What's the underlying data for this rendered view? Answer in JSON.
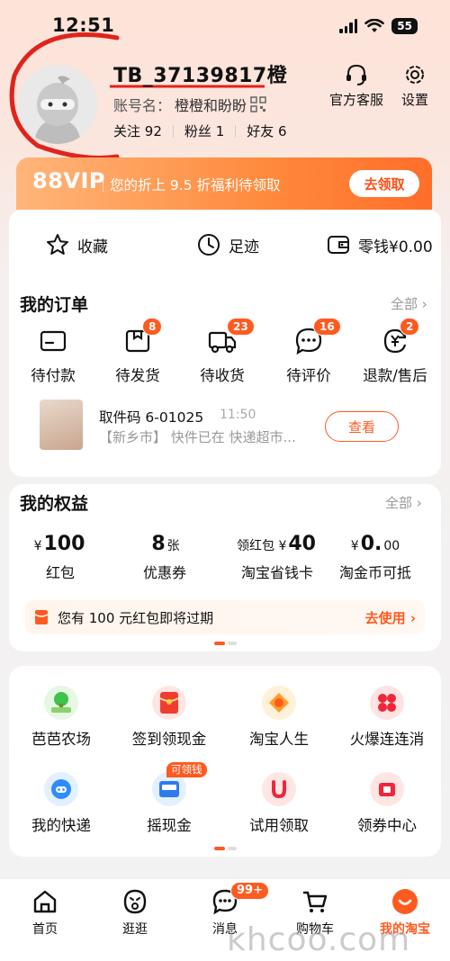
{
  "status_bar": {
    "time": "12:51",
    "battery": "55"
  },
  "profile": {
    "username": "TB_37139817橙",
    "account_label": "账号名：",
    "account_name": "橙橙和盼盼",
    "follow_label": "关注",
    "follow_count": "92",
    "fans_label": "粉丝",
    "fans_count": "1",
    "friends_label": "好友",
    "friends_count": "6"
  },
  "top_actions": {
    "service": "官方客服",
    "settings": "设置"
  },
  "vip": {
    "logo": "88VIP",
    "text": "您的折上 9.5 折福利待领取",
    "button": "去领取"
  },
  "quick_links": {
    "favorites": "收藏",
    "footprints": "足迹",
    "wallet": "零钱¥0.00"
  },
  "orders": {
    "title": "我的订单",
    "more": "全部",
    "items": [
      {
        "label": "待付款",
        "badge": ""
      },
      {
        "label": "待发货",
        "badge": "8"
      },
      {
        "label": "待收货",
        "badge": "23"
      },
      {
        "label": "待评价",
        "badge": "16"
      },
      {
        "label": "退款/售后",
        "badge": "2"
      }
    ],
    "package": {
      "code": "取件码 6-01025",
      "time": "11:50",
      "desc": "【新乡市】 快件已在 快递超市...",
      "button": "查看"
    }
  },
  "rights": {
    "title": "我的权益",
    "more": "全部",
    "items": [
      {
        "prefix": "¥",
        "value": "100",
        "suffix": "",
        "label": "红包"
      },
      {
        "prefix": "",
        "value": "8",
        "suffix": "张",
        "label": "优惠券"
      },
      {
        "prefix": "领红包 ¥",
        "value": "40",
        "suffix": "",
        "label": "淘宝省钱卡"
      },
      {
        "prefix": "¥",
        "value": "0.",
        "suffix": "00",
        "label": "淘金币可抵"
      }
    ],
    "notice": "您有 100 元红包即将过期",
    "notice_action": "去使用"
  },
  "apps": [
    {
      "label": "芭芭农场",
      "tag": ""
    },
    {
      "label": "签到领现金",
      "tag": ""
    },
    {
      "label": "淘宝人生",
      "tag": ""
    },
    {
      "label": "火爆连连消",
      "tag": ""
    },
    {
      "label": "我的快递",
      "tag": ""
    },
    {
      "label": "摇现金",
      "tag": "可领钱"
    },
    {
      "label": "试用领取",
      "tag": ""
    },
    {
      "label": "领券中心",
      "tag": ""
    }
  ],
  "tabbar": {
    "home": "首页",
    "browse": "逛逛",
    "messages": "消息",
    "messages_badge": "99+",
    "cart": "购物车",
    "mine": "我的淘宝"
  },
  "watermark": "khcoo.com",
  "colors": {
    "accent": "#ff5a1f",
    "vip_gradient_start": "#ffb57a",
    "vip_gradient_end": "#ff6e2a"
  }
}
